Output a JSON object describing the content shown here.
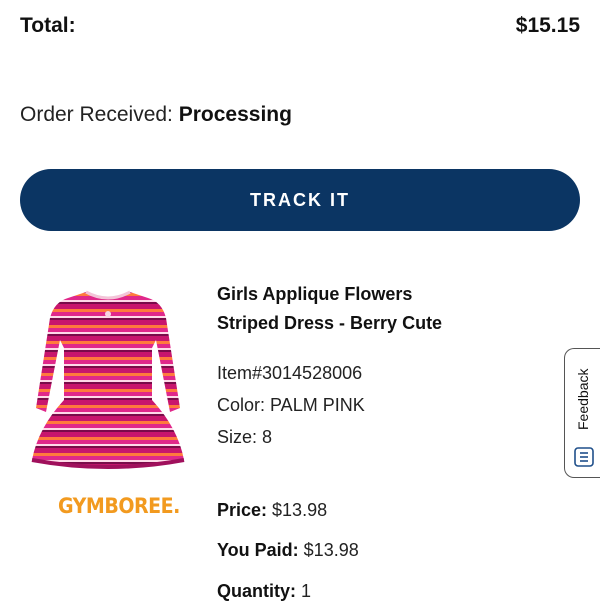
{
  "order": {
    "total_label": "Total:",
    "total_value": "$15.15",
    "status_label": "Order Received: ",
    "status_value": "Processing",
    "track_button_label": "TRACK IT"
  },
  "product": {
    "name": "Girls Applique Flowers Striped Dress - Berry Cute",
    "item_number": "Item#3014528006",
    "color": "Color: PALM PINK",
    "size": "Size: 8",
    "price_label": "Price:",
    "price_value": " $13.98",
    "paid_label": "You Paid:",
    "paid_value": " $13.98",
    "quantity_label": "Quantity:",
    "quantity_value": " 1",
    "brand": "GYMBOREE."
  },
  "feedback": {
    "label": "Feedback"
  },
  "colors": {
    "track_button": "#0b3563",
    "brand_orange": "#f29a1f"
  }
}
